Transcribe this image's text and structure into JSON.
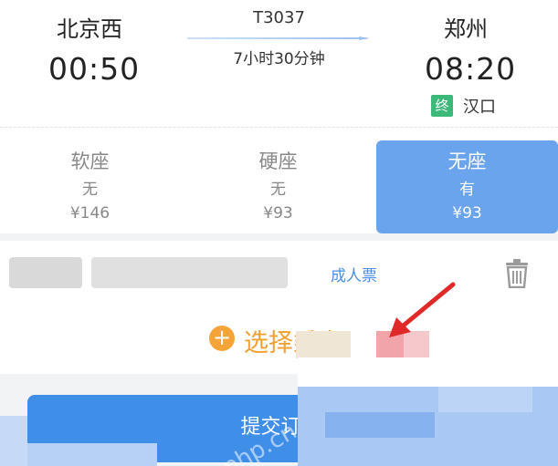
{
  "trip": {
    "from_station": "北京西",
    "to_station": "郑州",
    "train_number": "T3037",
    "depart_time": "00:50",
    "arrive_time": "08:20",
    "duration": "7小时30分钟",
    "terminal_badge": "终",
    "terminal_station": "汉口"
  },
  "seats": [
    {
      "name": "软座",
      "availability": "无",
      "price": "¥146",
      "selected": false
    },
    {
      "name": "硬座",
      "availability": "无",
      "price": "¥93",
      "selected": false
    },
    {
      "name": "无座",
      "availability": "有",
      "price": "¥93",
      "selected": true
    }
  ],
  "passenger": {
    "ticket_type": "成人票",
    "delete_icon": "trash-icon"
  },
  "add_passenger": {
    "icon": "plus-circle-icon",
    "label": "选择乘客"
  },
  "submit": {
    "label": "提交订单"
  },
  "watermark": "php.cn",
  "colors": {
    "accent_blue": "#3f8ee8",
    "selected_seat": "#6aa4ed",
    "orange": "#f5a43a",
    "terminal_green": "#3cb878",
    "arrow_red": "#e02a2a"
  }
}
